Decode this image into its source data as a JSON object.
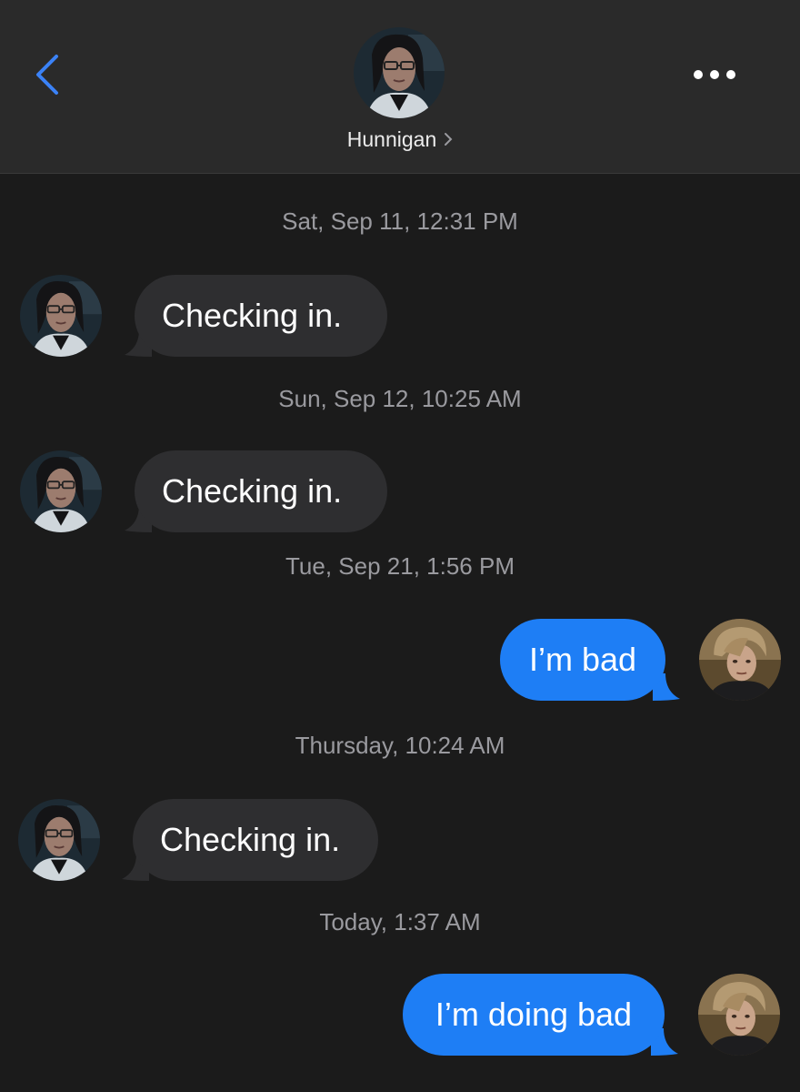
{
  "header": {
    "contact_name": "Hunnigan",
    "back_icon": "chevron-left-icon",
    "more_icon": "ellipsis-icon",
    "name_chevron_icon": "chevron-right-icon",
    "accent_color": "#3b82f6"
  },
  "colors": {
    "background": "#1b1b1b",
    "incoming_bubble": "#2e2e30",
    "outgoing_bubble": "#1e7ef5",
    "timestamp": "#9a9a9f"
  },
  "conversation": [
    {
      "timestamp": "Sat, Sep 11, 12:31 PM",
      "sender": "Hunnigan",
      "direction": "incoming",
      "text": "Checking in."
    },
    {
      "timestamp": "Sun, Sep 12, 10:25 AM",
      "sender": "Hunnigan",
      "direction": "incoming",
      "text": "Checking in."
    },
    {
      "timestamp": "Tue, Sep 21, 1:56 PM",
      "sender": "me",
      "direction": "outgoing",
      "text": "I’m bad"
    },
    {
      "timestamp": "Thursday, 10:24 AM",
      "sender": "Hunnigan",
      "direction": "incoming",
      "text": "Checking in."
    },
    {
      "timestamp": "Today, 1:37 AM",
      "sender": "me",
      "direction": "outgoing",
      "text": "I’m doing bad"
    }
  ]
}
